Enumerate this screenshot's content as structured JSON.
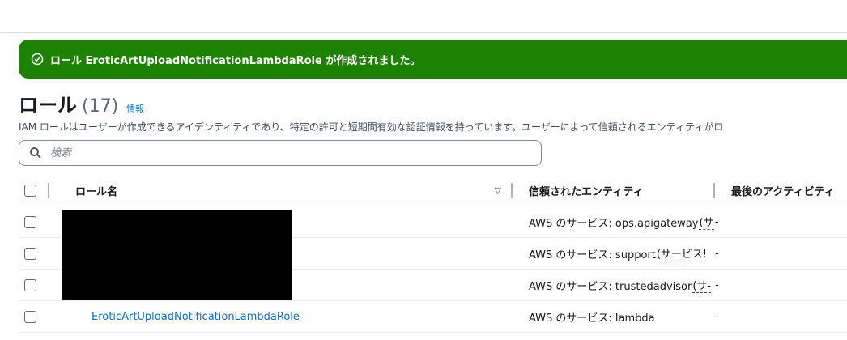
{
  "flash": {
    "message": "ロール EroticArtUploadNotificationLambdaRole が作成されました。",
    "color": "#1d8102"
  },
  "heading": {
    "title": "ロール",
    "count": "(17)",
    "info_link": "情報"
  },
  "description": "IAM ロールはユーザーが作成できるアイデンティティであり、特定の許可と短期間有効な認証情報を持っています。ユーザーによって信頼されるエンティティがロ",
  "search": {
    "placeholder": "検索"
  },
  "table": {
    "columns": {
      "name": "ロール名",
      "trusted": "信頼されたエンティティ",
      "last_activity": "最後のアクティビティ"
    },
    "rows": [
      {
        "name": "",
        "trusted_prefix": "AWS のサービス: ops.apigateway",
        "trusted_suffix": "(サ",
        "last": "-"
      },
      {
        "name": "",
        "trusted_prefix": "AWS のサービス: support",
        "trusted_suffix": "(サービス!",
        "last": "-"
      },
      {
        "name": "",
        "trusted_prefix": "AWS のサービス: trustedadvisor",
        "trusted_suffix": "(サ-",
        "last": "-"
      },
      {
        "name": "EroticArtUploadNotificationLambdaRole",
        "trusted_prefix": "AWS のサービス: lambda",
        "trusted_suffix": "",
        "last": "-"
      }
    ]
  },
  "colors": {
    "link": "#0972d3",
    "redaction": "#000000"
  }
}
